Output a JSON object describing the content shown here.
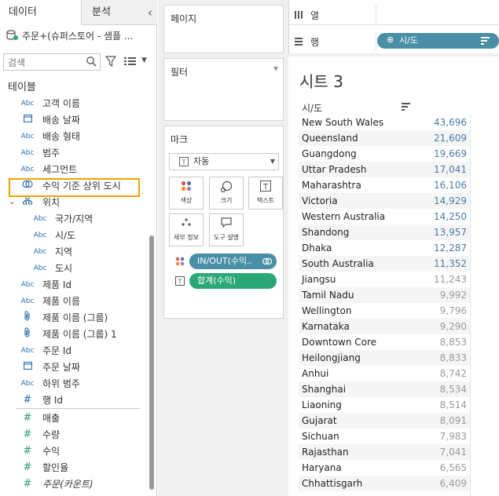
{
  "left_pane": {
    "tab_data": "데이터",
    "tab_analysis": "분석",
    "collapse_glyph": "‹",
    "datasource": "주문+(슈퍼스토어 - 샘플 ...",
    "search_placeholder": "검색",
    "section_title": "테이블",
    "fields": [
      {
        "icon": "Abc",
        "label": "고객 이름",
        "indent": 0,
        "kind": "dim"
      },
      {
        "icon": "date",
        "label": "배송 날짜",
        "indent": 0,
        "kind": "dim"
      },
      {
        "icon": "Abc",
        "label": "배송 형태",
        "indent": 0,
        "kind": "dim"
      },
      {
        "icon": "Abc",
        "label": "범주",
        "indent": 0,
        "kind": "dim"
      },
      {
        "icon": "Abc",
        "label": "세그먼트",
        "indent": 0,
        "kind": "dim"
      },
      {
        "icon": "set",
        "label": "수익 기준 상위 도시",
        "indent": 0,
        "kind": "dim"
      },
      {
        "icon": "hier",
        "label": "위치",
        "indent": -1,
        "kind": "dim"
      },
      {
        "icon": "Abc",
        "label": "국가/지역",
        "indent": 1,
        "kind": "dim"
      },
      {
        "icon": "Abc",
        "label": "시/도",
        "indent": 1,
        "kind": "dim"
      },
      {
        "icon": "Abc",
        "label": "지역",
        "indent": 1,
        "kind": "dim"
      },
      {
        "icon": "Abc",
        "label": "도시",
        "indent": 1,
        "kind": "dim"
      },
      {
        "icon": "Abc",
        "label": "제품 Id",
        "indent": 0,
        "kind": "dim"
      },
      {
        "icon": "Abc",
        "label": "제품 이름",
        "indent": 0,
        "kind": "dim"
      },
      {
        "icon": "clip",
        "label": "제품 이름 (그룹)",
        "indent": 0,
        "kind": "dim"
      },
      {
        "icon": "clip",
        "label": "제품 이름 (그룹) 1",
        "indent": 0,
        "kind": "dim"
      },
      {
        "icon": "Abc",
        "label": "주문 Id",
        "indent": 0,
        "kind": "dim"
      },
      {
        "icon": "date",
        "label": "주문 날짜",
        "indent": 0,
        "kind": "dim"
      },
      {
        "icon": "Abc",
        "label": "하위 범주",
        "indent": 0,
        "kind": "dim"
      },
      {
        "icon": "#",
        "label": "행 Id",
        "indent": 0,
        "kind": "dim"
      },
      {
        "icon": "#",
        "label": "매출",
        "indent": 0,
        "kind": "measure"
      },
      {
        "icon": "#",
        "label": "수량",
        "indent": 0,
        "kind": "measure"
      },
      {
        "icon": "#",
        "label": "수익",
        "indent": 0,
        "kind": "measure"
      },
      {
        "icon": "#",
        "label": "할인율",
        "indent": 0,
        "kind": "measure"
      },
      {
        "icon": "#",
        "label": "주문(카운트)",
        "indent": 0,
        "kind": "measure",
        "italic": true
      }
    ]
  },
  "pages_card": {
    "title": "페이지"
  },
  "filters_card": {
    "title": "필터"
  },
  "marks_card": {
    "title": "마크",
    "mark_type": "자동",
    "buttons": {
      "color": "색상",
      "size": "크기",
      "label": "텍스트",
      "detail": "세부 정보",
      "tooltip": "도구 설명"
    },
    "pill_set": "IN/OUT(수익..",
    "pill_sum": "합계(수익)"
  },
  "shelves": {
    "columns_label": "열",
    "rows_label": "행",
    "rows_pill": "시/도"
  },
  "sheet": {
    "title": "시트 3",
    "column_header": "시/도",
    "rows": [
      {
        "name": "New South Wales",
        "value": "43,696",
        "in": true
      },
      {
        "name": "Queensland",
        "value": "21,609",
        "in": true
      },
      {
        "name": "Guangdong",
        "value": "19,669",
        "in": true
      },
      {
        "name": "Uttar Pradesh",
        "value": "17,041",
        "in": true
      },
      {
        "name": "Maharashtra",
        "value": "16,106",
        "in": true
      },
      {
        "name": "Victoria",
        "value": "14,929",
        "in": true
      },
      {
        "name": "Western Australia",
        "value": "14,250",
        "in": true
      },
      {
        "name": "Shandong",
        "value": "13,957",
        "in": true
      },
      {
        "name": "Dhaka",
        "value": "12,287",
        "in": true
      },
      {
        "name": "South Australia",
        "value": "11,352",
        "in": true
      },
      {
        "name": "Jiangsu",
        "value": "11,243",
        "in": false
      },
      {
        "name": "Tamil Nadu",
        "value": "9,992",
        "in": false
      },
      {
        "name": "Wellington",
        "value": "9,796",
        "in": false
      },
      {
        "name": "Karnataka",
        "value": "9,290",
        "in": false
      },
      {
        "name": "Downtown Core",
        "value": "8,853",
        "in": false
      },
      {
        "name": "Heilongjiang",
        "value": "8,833",
        "in": false
      },
      {
        "name": "Anhui",
        "value": "8,742",
        "in": false
      },
      {
        "name": "Shanghai",
        "value": "8,534",
        "in": false
      },
      {
        "name": "Liaoning",
        "value": "8,514",
        "in": false
      },
      {
        "name": "Gujarat",
        "value": "8,091",
        "in": false
      },
      {
        "name": "Sichuan",
        "value": "7,983",
        "in": false
      },
      {
        "name": "Rajasthan",
        "value": "7,041",
        "in": false
      },
      {
        "name": "Haryana",
        "value": "6,565",
        "in": false
      },
      {
        "name": "Chhattisgarh",
        "value": "6,409",
        "in": false
      }
    ]
  },
  "colors": {
    "in_value": "#4e79a7",
    "out_value": "#9a9a9a",
    "pill_blue": "#4b8fa6",
    "pill_green": "#2aa876",
    "highlight": "#f2a100"
  }
}
